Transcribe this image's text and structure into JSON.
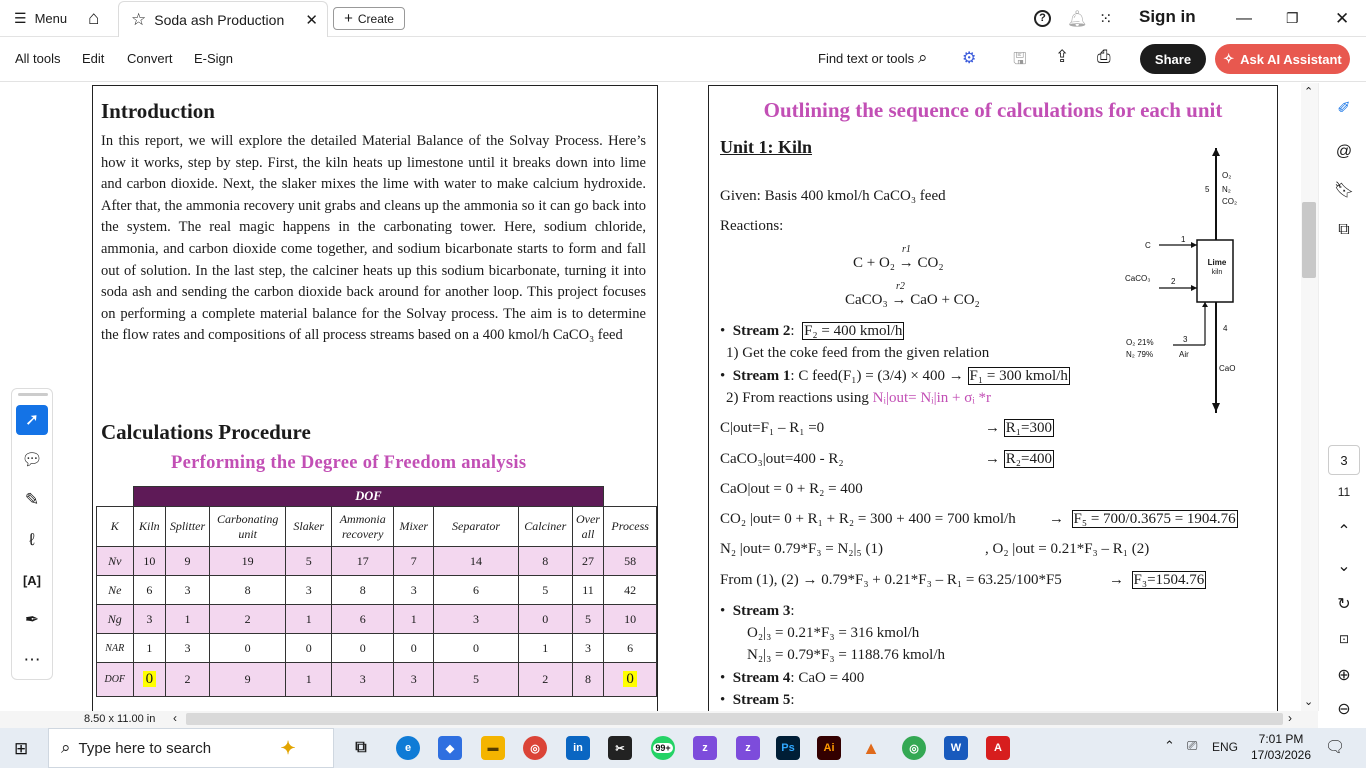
{
  "titlebar": {
    "menu_label": "Menu",
    "tab_title": "Soda ash Production",
    "create_label": "Create",
    "sign_in": "Sign in"
  },
  "toolbar": {
    "menus": [
      "All tools",
      "Edit",
      "Convert",
      "E-Sign"
    ],
    "find_placeholder": "Find text or tools",
    "share_label": "Share",
    "ask_ai_label": "Ask AI Assistant"
  },
  "page1": {
    "intro_heading": "Introduction",
    "intro_text": "In this report, we will explore the detailed Material Balance of the Solvay Process. Here’s how it works, step by step. First, the kiln heats up limestone until it breaks down into lime and carbon dioxide. Next, the slaker mixes the lime with water to make calcium hydroxide. After that, the ammonia recovery unit grabs and cleans up the ammonia so it can go back into the system. The real magic happens in the carbonating tower. Here, sodium chloride, ammonia, and carbon dioxide come together, and sodium bicarbonate starts to form and fall out of solution. In the last step, the calciner heats up this sodium bicarbonate, turning it into soda ash and sending the carbon dioxide back around for another loop. This project focuses on performing a complete material balance for the Solvay process. The aim is to determine the flow rates and compositions of all process streams based on a 400 kmol/h CaCO₃ feed",
    "calc_heading": "Calculations Procedure",
    "dof_heading": "Performing the Degree of Freedom analysis",
    "dof_table": {
      "group_header": "DOF",
      "columns": [
        "K",
        "Kiln",
        "Splitter",
        "Carbonating unit",
        "Slaker",
        "Ammonia recovery",
        "Mixer",
        "Separator",
        "Calciner",
        "Over all",
        "Process"
      ],
      "rows": [
        {
          "label": "Nv",
          "values": [
            "10",
            "9",
            "19",
            "5",
            "17",
            "7",
            "14",
            "8",
            "27",
            "58"
          ]
        },
        {
          "label": "Ne",
          "values": [
            "6",
            "3",
            "8",
            "3",
            "8",
            "3",
            "6",
            "5",
            "11",
            "42"
          ]
        },
        {
          "label": "Ng",
          "values": [
            "3",
            "1",
            "2",
            "1",
            "6",
            "1",
            "3",
            "0",
            "5",
            "10"
          ]
        },
        {
          "label": "NAR",
          "values": [
            "1",
            "3",
            "0",
            "0",
            "0",
            "0",
            "0",
            "1",
            "3",
            "6"
          ]
        },
        {
          "label": "DOF",
          "values": [
            "0",
            "2",
            "9",
            "1",
            "3",
            "3",
            "5",
            "2",
            "8",
            "0"
          ]
        }
      ]
    }
  },
  "page2": {
    "title": "Outlining the sequence of calculations for each unit",
    "unit_heading": "Unit 1: Kiln",
    "given": "Given: Basis 400 kmol/h CaCO₃ feed",
    "reactions_label": "Reactions:",
    "reaction1": "C + O₂ → CO₂",
    "reaction1_tag": "r1",
    "reaction2": "CaCO₃ → CaO + CO₂",
    "reaction2_tag": "r2",
    "stream2_label": "Stream 2",
    "stream2_box": "F₂ = 400 kmol/h",
    "step1": "1) Get the coke feed from the given relation",
    "stream1_label": "Stream 1",
    "stream1_text": ": C feed(F₁) = (3/4) × 400   →",
    "stream1_box": "F₁ = 300 kmol/h",
    "step2": "2) From reactions using",
    "step2_formula": "Nᵢ|out= Nᵢ|in + σᵢ *r",
    "eq_c": "C|out=F₁ – R₁ =0",
    "eq_c_res": "R₁=300",
    "eq_caco3": "CaCO₃|out=400 - R₂",
    "eq_caco3_res": "R₂=400",
    "eq_cao": "CaO|out = 0 + R₂ = 400",
    "eq_co2": "CO₂ |out= 0 + R₁ + R₂ = 300 + 400 = 700 kmol/h",
    "eq_co2_res": "F₅ = 700/0.3675 = 1904.76",
    "eq_n2": "N₂ |out= 0.79*F₃ = N₂|₅ (1)",
    "eq_o2": ", O₂ |out = 0.21*F₃ – R₁ (2)",
    "eq_from": "From (1), (2) → 0.79*F₃ + 0.21*F₃ – R₁ = 63.25/100*F5",
    "eq_from_res": "F₃=1504.76",
    "stream3_label": "Stream 3",
    "stream3_o2": "O₂|₃ =  0.21*F₃ = 316 kmol/h",
    "stream3_n2": "N₂|₃ = 0.79*F₃ = 1188.76 kmol/h",
    "stream4_label": "Stream 4",
    "stream4_text": ": CaO = 400",
    "stream5_label": "Stream 5",
    "diagram": {
      "unit_label_1": "Lime",
      "unit_label_2": "kiln",
      "s5_num": "5",
      "s5_species": [
        "O₂",
        "N₂",
        "CO₂"
      ],
      "s1_species": "C",
      "s1_num": "1",
      "s2_species": "CaCO₃",
      "s2_num": "2",
      "s3_species_1": "O₂ 21%",
      "s3_species_2": "N₂ 79%",
      "s3_num": "3",
      "s3_label": "Air",
      "s4_num": "4",
      "s4_species": "CaO"
    }
  },
  "status": {
    "page_size": "8.50 x 11.00 in",
    "current_page": "3",
    "total_pages": "11"
  },
  "taskbar": {
    "search_placeholder": "Type here to search",
    "language": "ENG",
    "time": "7:01 PM",
    "date": "17/03/2026",
    "badge_count": "99+"
  }
}
